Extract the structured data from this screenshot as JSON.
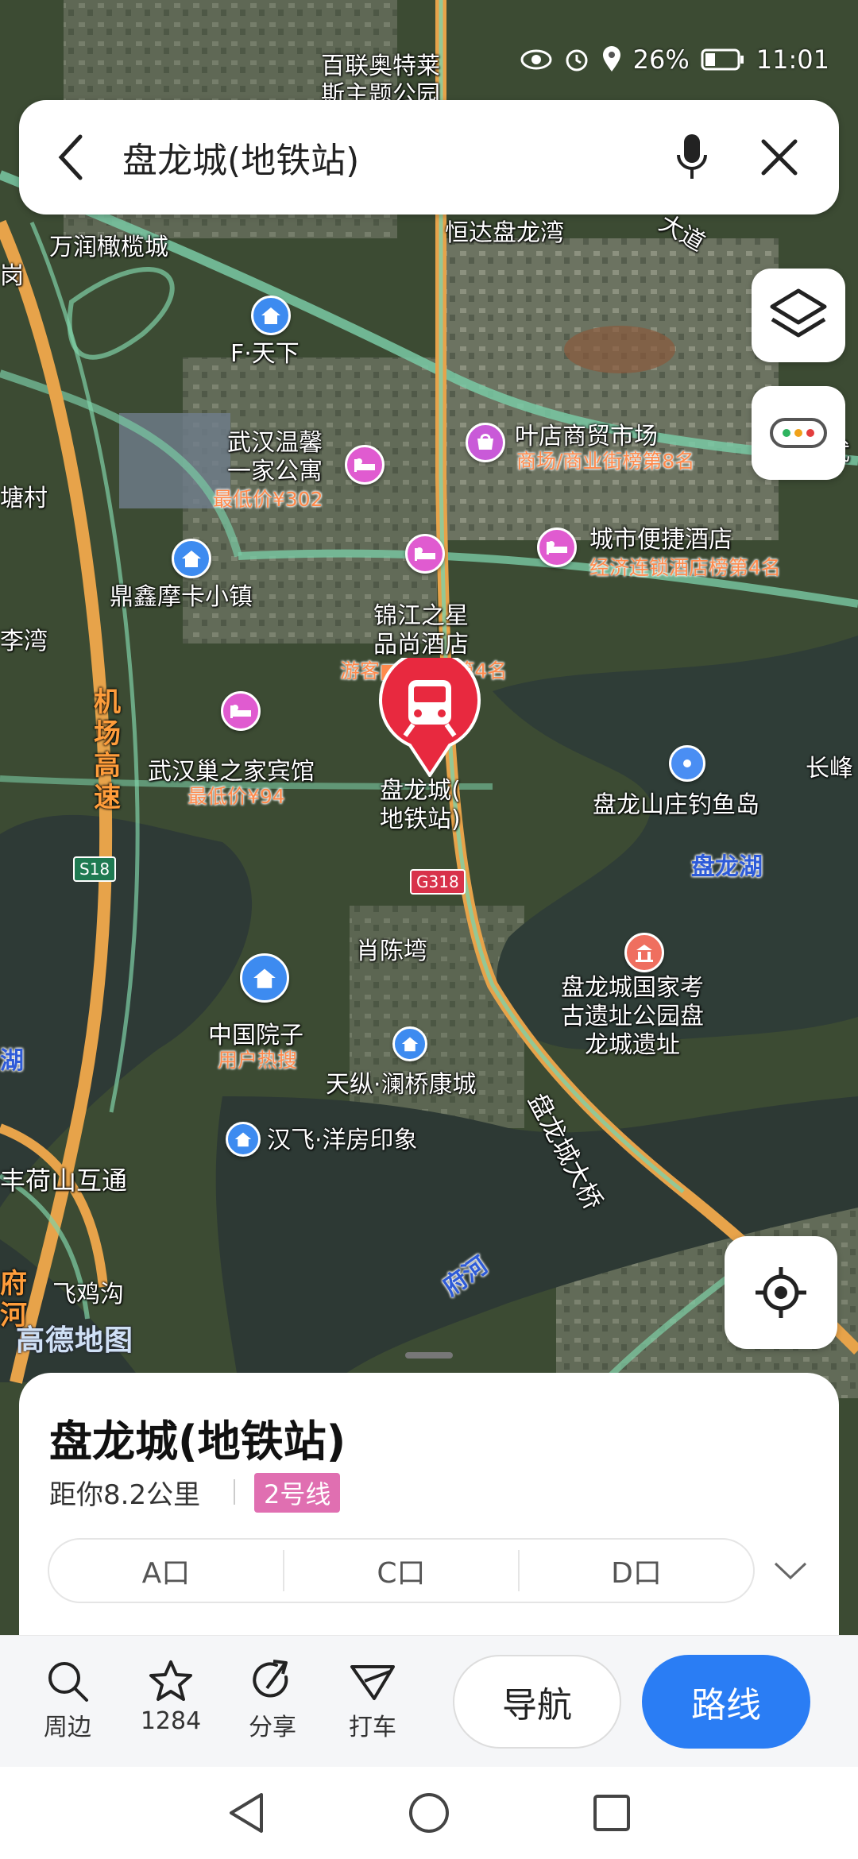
{
  "status_bar": {
    "battery": "26%",
    "time": "11:01"
  },
  "search": {
    "query": "盘龙城(地铁站)"
  },
  "map": {
    "labels": {
      "bailian": "百联奥特莱\n斯主题公园",
      "wanrun": "万润橄榄城",
      "gang": "岗",
      "hengda": "恒达盘龙湾",
      "ftx": "F·天下",
      "wuhanwenxin": "武汉温馨\n一家公寓",
      "wuhanwenxin_sub": "最低价¥302",
      "yedian": "叶店商贸市场",
      "yedian_sub": "商场/商业街榜第8名",
      "tangcun": "塘村",
      "chengshi": "城市便捷酒店",
      "chengshi_sub": "经济连锁酒店榜第4名",
      "dingxin": "鼎鑫摩卡小镇",
      "jinjiang": "锦江之星\n品尚酒店",
      "jinjiang_sub": "游客■■■■第4名",
      "liwan": "李湾",
      "jichang": "机\n场\n高\n速",
      "chaozhijia": "武汉巢之家宾馆",
      "chaozhijia_sub": "最低价¥94",
      "station": "盘龙城(\n地铁站)",
      "shanzhuang": "盘龙山庄钓鱼岛",
      "changfeng": "长峰",
      "panlonghu": "盘龙湖",
      "s18": "S18",
      "g318": "G318",
      "xiaochen": "肖陈塆",
      "site": "盘龙城国家考\n古遗址公园盘\n龙城遗址",
      "yuanzi": "中国院子",
      "yuanzi_sub": "用户热搜",
      "tianzong": "天纵·澜桥康城",
      "hu": "湖",
      "hanfei": "汉飞·洋房印象",
      "fenghe": "丰荷山互通",
      "bridge": "盘龙城大桥",
      "fuhe": "府河",
      "feiji": "飞鸡沟",
      "fu": "府\n河",
      "brand": "高德地图",
      "dadao": "大道",
      "wu": "武"
    }
  },
  "card": {
    "title": "盘龙城(地铁站)",
    "distance": "距你8.2公里",
    "line": "2号线",
    "exits": [
      "A口",
      "C口",
      "D口"
    ]
  },
  "actions": {
    "nearby": "周边",
    "favorites": "1284",
    "share": "分享",
    "taxi": "打车",
    "navigate": "导航",
    "route": "路线"
  },
  "colors": {
    "accent": "#2a7df4",
    "line2": "#e06fb1",
    "station_pin": "#e8293f"
  },
  "icons": [
    "back-icon",
    "mic-icon",
    "close-icon",
    "layers-icon",
    "traffic-icon",
    "locate-icon",
    "search-icon",
    "star-icon",
    "share-icon",
    "taxi-icon",
    "chevron-down-icon"
  ]
}
